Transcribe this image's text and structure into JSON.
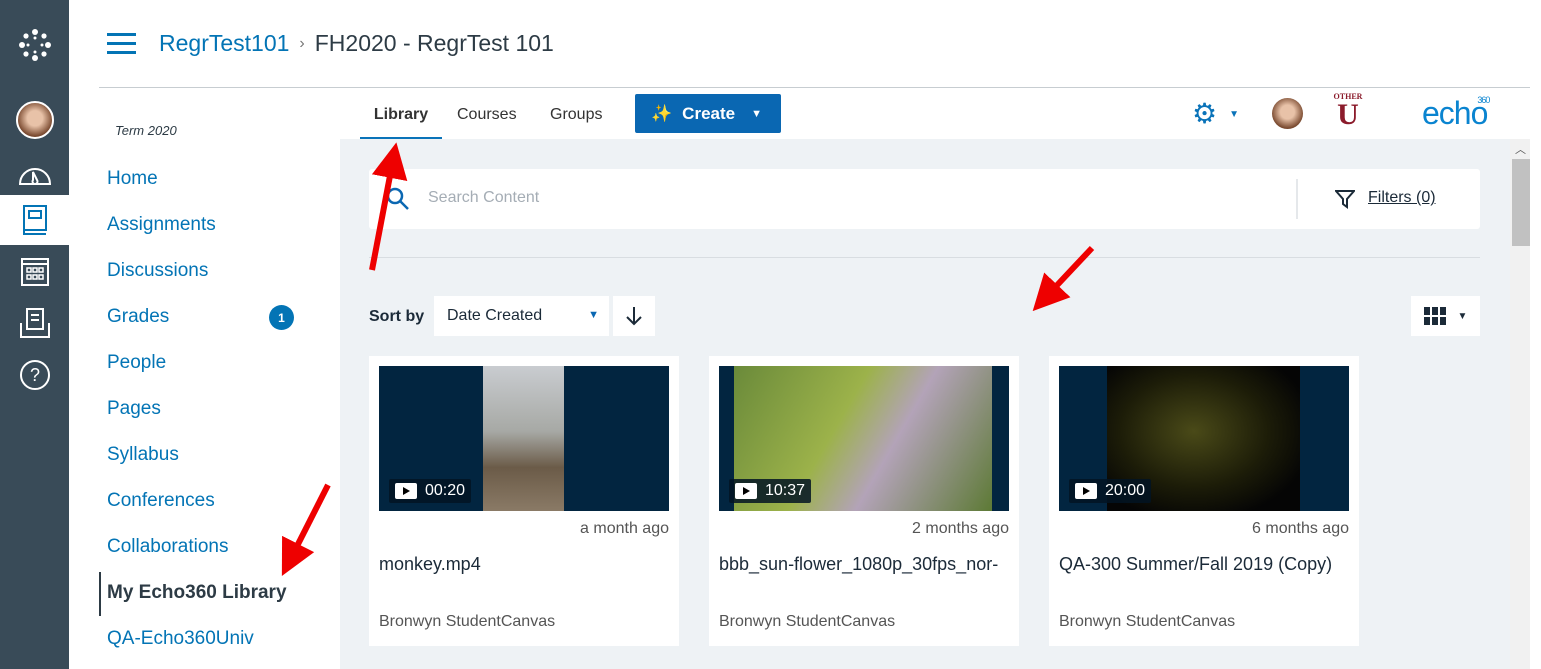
{
  "header": {
    "breadcrumb": [
      "RegrTest101",
      "FH2020 - RegrTest 101"
    ],
    "separator": "›"
  },
  "course_nav": {
    "term": "Term 2020",
    "items": [
      {
        "label": "Home"
      },
      {
        "label": "Assignments"
      },
      {
        "label": "Discussions"
      },
      {
        "label": "Grades",
        "badge": "1"
      },
      {
        "label": "People"
      },
      {
        "label": "Pages"
      },
      {
        "label": "Syllabus"
      },
      {
        "label": "Conferences"
      },
      {
        "label": "Collaborations"
      },
      {
        "label": "My Echo360 Library",
        "active": true
      },
      {
        "label": "QA-Echo360Univ"
      }
    ]
  },
  "global_nav": {
    "icons": [
      "canvas-logo-icon",
      "avatar",
      "dashboard-icon",
      "courses-icon",
      "calendar-icon",
      "inbox-icon",
      "help-icon"
    ],
    "active": "courses-icon"
  },
  "echo": {
    "tabs": [
      {
        "label": "Library",
        "active": true
      },
      {
        "label": "Courses"
      },
      {
        "label": "Groups"
      }
    ],
    "create_label": "Create",
    "logo": "echo",
    "logo_sup": "360",
    "institution_logo": "OTHER U",
    "search_placeholder": "Search Content",
    "filters_label": "Filters (0)",
    "sort_label": "Sort by",
    "sort_value": "Date Created",
    "cards": [
      {
        "duration": "00:20",
        "date": "a month ago",
        "title": "monkey.mp4",
        "author": "Bronwyn StudentCanvas"
      },
      {
        "duration": "10:37",
        "date": "2 months ago",
        "title": "bbb_sun-flower_1080p_30fps_nor-",
        "author": "Bronwyn StudentCanvas"
      },
      {
        "duration": "20:00",
        "date": "6 months ago",
        "title": "QA-300 Summer/Fall 2019 (Copy)",
        "author": "Bronwyn StudentCanvas"
      }
    ]
  },
  "colors": {
    "rail": "#394b58",
    "link": "#0374b5",
    "create": "#0a67b2",
    "content_bg": "#eef2f5",
    "annotation": "#ee0000"
  }
}
